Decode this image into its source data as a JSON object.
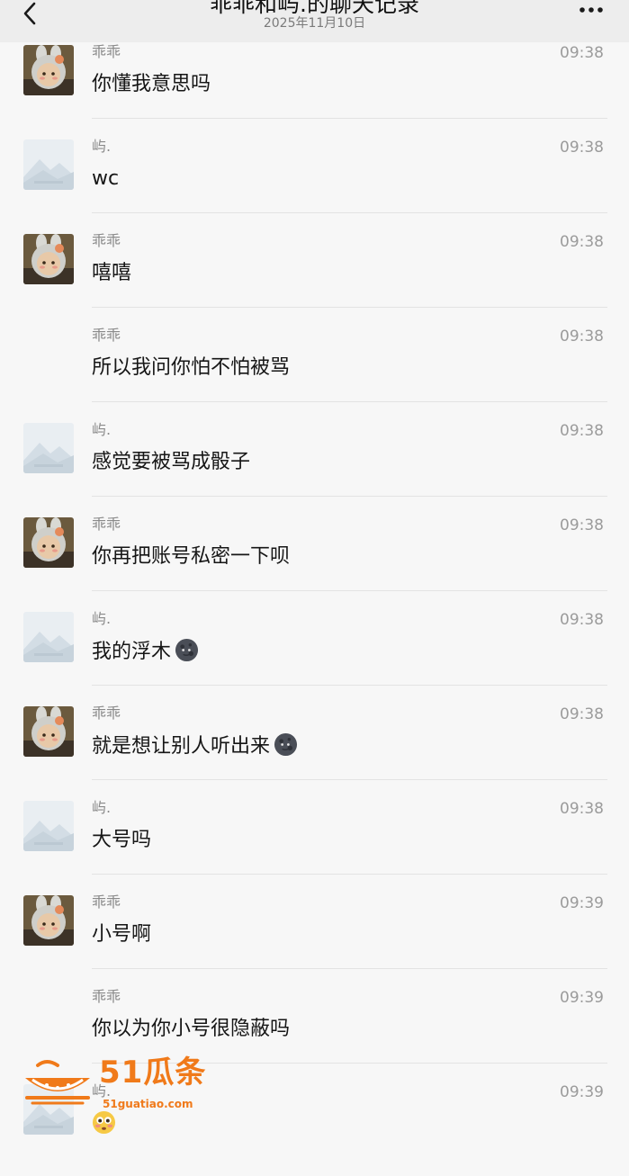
{
  "header": {
    "title": "乖乖和屿.的聊天记录",
    "subtitle": "2025年11月10日"
  },
  "colors": {
    "header_bg": "#ededed",
    "page_bg": "#f7f7f7",
    "watermark": "#f07a1a"
  },
  "messages": [
    {
      "sender": "乖乖",
      "time": "09:38",
      "text": "你懂我意思吗",
      "avatar": "bunny-doll-avatar",
      "emoji": ""
    },
    {
      "sender": "屿.",
      "time": "09:38",
      "text": "wc",
      "avatar": "placeholder-avatar",
      "emoji": ""
    },
    {
      "sender": "乖乖",
      "time": "09:38",
      "text": "嘻嘻",
      "avatar": "bunny-doll-avatar",
      "emoji": ""
    },
    {
      "sender": "乖乖",
      "time": "09:38",
      "text": "所以我问你怕不怕被骂",
      "avatar": "",
      "emoji": ""
    },
    {
      "sender": "屿.",
      "time": "09:38",
      "text": "感觉要被骂成骰子",
      "avatar": "placeholder-avatar",
      "emoji": ""
    },
    {
      "sender": "乖乖",
      "time": "09:38",
      "text": "你再把账号私密一下呗",
      "avatar": "bunny-doll-avatar",
      "emoji": ""
    },
    {
      "sender": "屿.",
      "time": "09:38",
      "text": "我的浮木",
      "avatar": "placeholder-avatar",
      "emoji": "new-moon-face-emoji"
    },
    {
      "sender": "乖乖",
      "time": "09:38",
      "text": "就是想让别人听出来",
      "avatar": "bunny-doll-avatar",
      "emoji": "new-moon-face-emoji"
    },
    {
      "sender": "屿.",
      "time": "09:38",
      "text": "大号吗",
      "avatar": "placeholder-avatar",
      "emoji": ""
    },
    {
      "sender": "乖乖",
      "time": "09:39",
      "text": "小号啊",
      "avatar": "bunny-doll-avatar",
      "emoji": ""
    },
    {
      "sender": "乖乖",
      "time": "09:39",
      "text": "你以为你小号很隐蔽吗",
      "avatar": "",
      "emoji": ""
    },
    {
      "sender": "屿.",
      "time": "09:39",
      "text": "",
      "avatar": "placeholder-avatar",
      "emoji": "flushed-face-emoji"
    }
  ],
  "watermark": {
    "brand": "51瓜条",
    "url": "51guatiao.com"
  }
}
